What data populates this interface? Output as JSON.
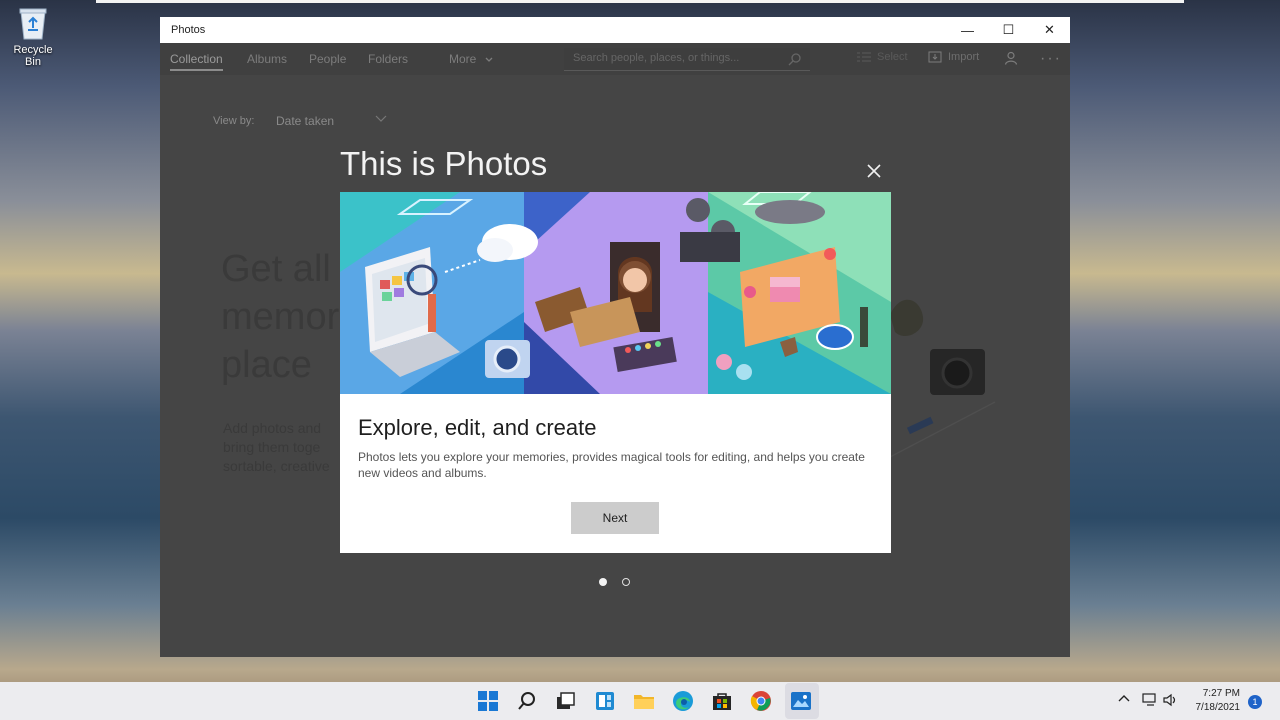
{
  "desktop": {
    "recycle_bin_label": "Recycle Bin"
  },
  "window": {
    "title": "Photos",
    "controls": {
      "minimize": "—",
      "maximize": "☐",
      "close": "✕"
    }
  },
  "nav": {
    "tabs": [
      "Collection",
      "Albums",
      "People",
      "Folders",
      "More"
    ],
    "search_placeholder": "Search people, places, or things...",
    "select_label": "Select",
    "import_label": "Import"
  },
  "collection": {
    "view_by_label": "View by:",
    "view_by_value": "Date taken",
    "heading_lines": [
      "Get all",
      "memor",
      "place"
    ],
    "para_lines": [
      "Add photos and",
      "bring them toge",
      "sortable, creative"
    ]
  },
  "dialog": {
    "title": "This is Photos",
    "heading": "Explore, edit, and create",
    "body": "Photos lets you explore your memories, provides magical tools for editing, and helps you create new videos and albums.",
    "next_label": "Next",
    "pages": 2,
    "current_page": 1
  },
  "taskbar": {
    "time": "7:27 PM",
    "date": "7/18/2021",
    "notification_count": "1",
    "apps": [
      "start-icon",
      "search-icon",
      "task-view-icon",
      "widgets-icon",
      "file-explorer-icon",
      "edge-icon",
      "store-icon",
      "chrome-icon",
      "photos-icon"
    ]
  },
  "colors": {
    "accent": "#1f63c8",
    "window_bg": "#454545",
    "dialog_bg": "#ffffff"
  }
}
